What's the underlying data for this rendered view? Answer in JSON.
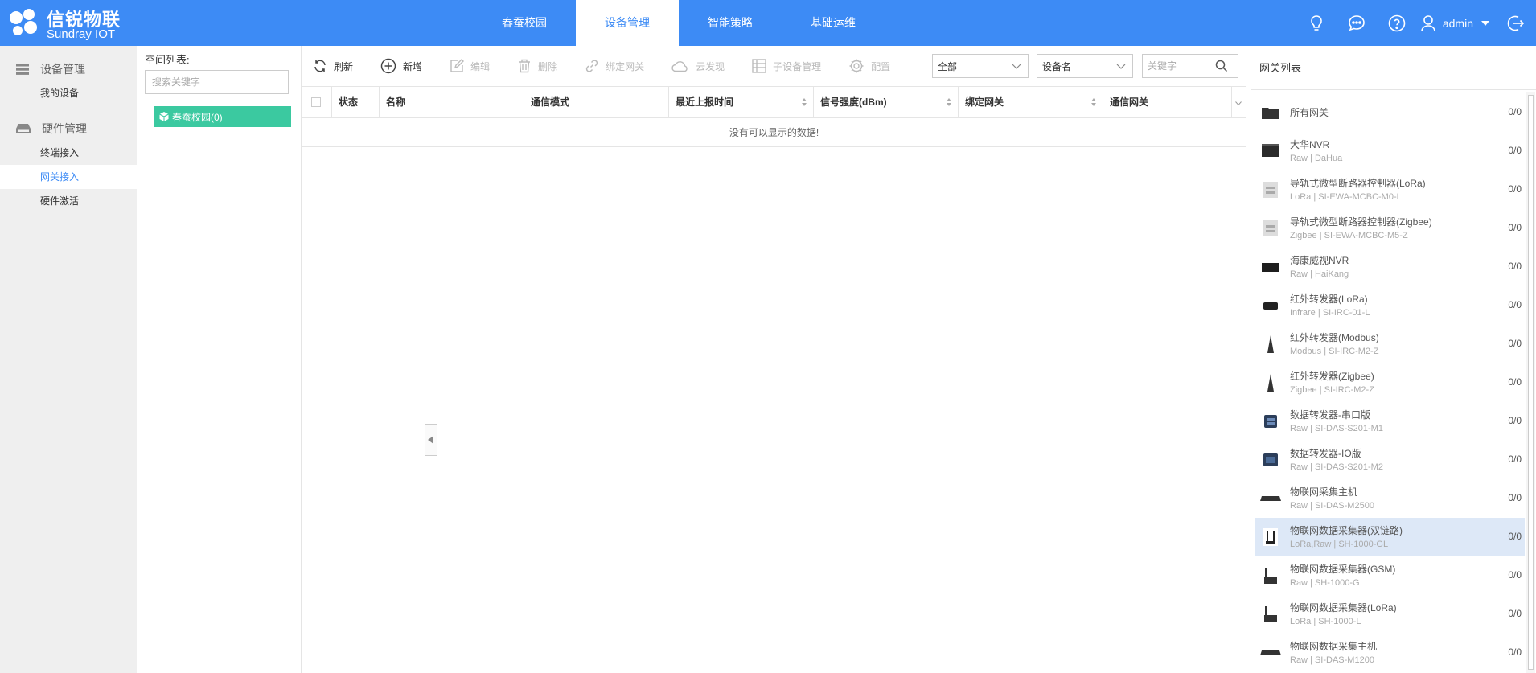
{
  "app": {
    "logo_title": "信锐物联",
    "logo_subtitle": "Sundray IOT"
  },
  "nav": {
    "items": [
      {
        "label": "春蚕校园"
      },
      {
        "label": "设备管理",
        "active": true
      },
      {
        "label": "智能策略"
      },
      {
        "label": "基础运维"
      }
    ]
  },
  "user": {
    "name": "admin"
  },
  "leftmenu": {
    "group1": "设备管理",
    "group1_items": [
      "我的设备"
    ],
    "group2": "硬件管理",
    "group2_items": [
      "终端接入",
      "网关接入",
      "硬件激活"
    ],
    "active": "网关接入"
  },
  "space": {
    "title": "空间列表:",
    "search_placeholder": "搜索关键字",
    "node": "春蚕校园(0)"
  },
  "toolbar": {
    "refresh": "刷新",
    "add": "新增",
    "edit": "编辑",
    "delete": "删除",
    "bind": "绑定网关",
    "cloud": "云发现",
    "subdevice": "子设备管理",
    "config": "配置",
    "filter1": "全部",
    "filter2": "设备名",
    "keyword_placeholder": "关键字"
  },
  "table": {
    "columns": [
      "状态",
      "名称",
      "通信模式",
      "最近上报时间",
      "信号强度(dBm)",
      "绑定网关",
      "通信网关"
    ],
    "empty": "没有可以显示的数据!"
  },
  "gateways": {
    "title": "网关列表",
    "items": [
      {
        "name": "所有网关",
        "sub": "",
        "count": "0/0"
      },
      {
        "name": "大华NVR",
        "sub": "Raw | DaHua",
        "count": "0/0"
      },
      {
        "name": "导轨式微型断路器控制器(LoRa)",
        "sub": "LoRa | SI-EWA-MCBC-M0-L",
        "count": "0/0"
      },
      {
        "name": "导轨式微型断路器控制器(Zigbee)",
        "sub": "Zigbee | SI-EWA-MCBC-M5-Z",
        "count": "0/0"
      },
      {
        "name": "海康威视NVR",
        "sub": "Raw | HaiKang",
        "count": "0/0"
      },
      {
        "name": "红外转发器(LoRa)",
        "sub": "Infrare | SI-IRC-01-L",
        "count": "0/0"
      },
      {
        "name": "红外转发器(Modbus)",
        "sub": "Modbus | SI-IRC-M2-Z",
        "count": "0/0"
      },
      {
        "name": "红外转发器(Zigbee)",
        "sub": "Zigbee | SI-IRC-M2-Z",
        "count": "0/0"
      },
      {
        "name": "数据转发器-串口版",
        "sub": "Raw | SI-DAS-S201-M1",
        "count": "0/0"
      },
      {
        "name": "数据转发器-IO版",
        "sub": "Raw | SI-DAS-S201-M2",
        "count": "0/0"
      },
      {
        "name": "物联网采集主机",
        "sub": "Raw | SI-DAS-M2500",
        "count": "0/0"
      },
      {
        "name": "物联网数据采集器(双链路)",
        "sub": "LoRa,Raw | SH-1000-GL",
        "count": "0/0",
        "selected": true
      },
      {
        "name": "物联网数据采集器(GSM)",
        "sub": "Raw | SH-1000-G",
        "count": "0/0"
      },
      {
        "name": "物联网数据采集器(LoRa)",
        "sub": "LoRa | SH-1000-L",
        "count": "0/0"
      },
      {
        "name": "物联网数据采集主机",
        "sub": "Raw | SI-DAS-M1200",
        "count": "0/0"
      }
    ]
  },
  "colors": {
    "primary": "#3d8bf5",
    "node": "#3bc9a0",
    "selected": "#dde8f7"
  }
}
